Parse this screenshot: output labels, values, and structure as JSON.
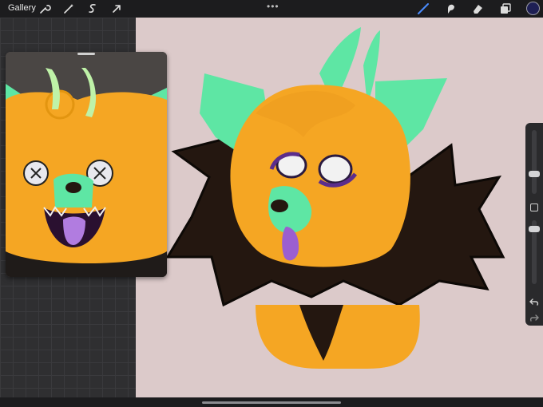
{
  "topbar": {
    "gallery_label": "Gallery",
    "more_glyph": "•••",
    "left_tools": [
      "wrench-icon",
      "magic-wand-icon",
      "selection-icon",
      "transform-arrow-icon"
    ],
    "right_tools": [
      "brush-icon",
      "smudge-icon",
      "eraser-icon",
      "layers-icon"
    ],
    "active_color": "#1e1f54"
  },
  "sidebar": {
    "brush_size_level": 0.45,
    "opacity_level": 0.55
  },
  "colors": {
    "canvas": "#dccaca",
    "fur_orange": "#f5a623",
    "mint": "#5ee6a4",
    "dark_fur": "#241710",
    "tongue": "#9b5fd0",
    "active_tool": "#4a8cff"
  }
}
